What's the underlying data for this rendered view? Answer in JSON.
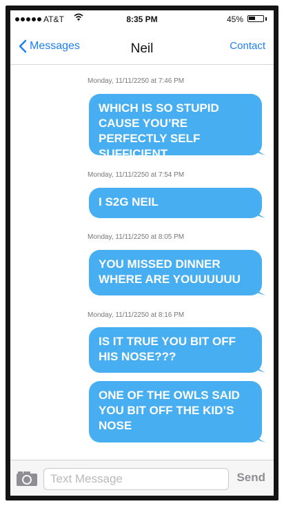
{
  "status_bar": {
    "carrier": "AT&T",
    "time": "8:35 PM",
    "battery_percent": "45%",
    "battery_level": 0.45,
    "signal_icon": "signal-dots-icon",
    "wifi_icon": "wifi-icon",
    "battery_icon": "battery-icon"
  },
  "nav": {
    "back_label": "Messages",
    "title": "Neil",
    "contact_label": "Contact"
  },
  "messages": [
    {
      "timestamp": "Monday, 11/11/2250 at 7:46 PM",
      "bubbles": [
        "WHICH IS SO STUPID CAUSE YOU’RE PERFECTLY SELF SUFFICIENT"
      ]
    },
    {
      "timestamp": "Monday, 11/11/2250 at 7:54 PM",
      "bubbles": [
        "I S2G NEIL"
      ]
    },
    {
      "timestamp": "Monday, 11/11/2250 at 8:05 PM",
      "bubbles": [
        "YOU MISSED DINNER WHERE ARE YOUUUUUU"
      ]
    },
    {
      "timestamp": "Monday, 11/11/2250 at 8:16 PM",
      "bubbles": [
        "IS IT TRUE YOU BIT OFF HIS NOSE???",
        "ONE OF THE OWLS SAID YOU BIT OFF THE KID’S NOSE"
      ]
    }
  ],
  "input": {
    "placeholder": "Text Message",
    "send_label": "Send",
    "camera_icon": "camera-icon"
  },
  "colors": {
    "bubble": "#47aff1",
    "accent": "#1c7ef5"
  }
}
